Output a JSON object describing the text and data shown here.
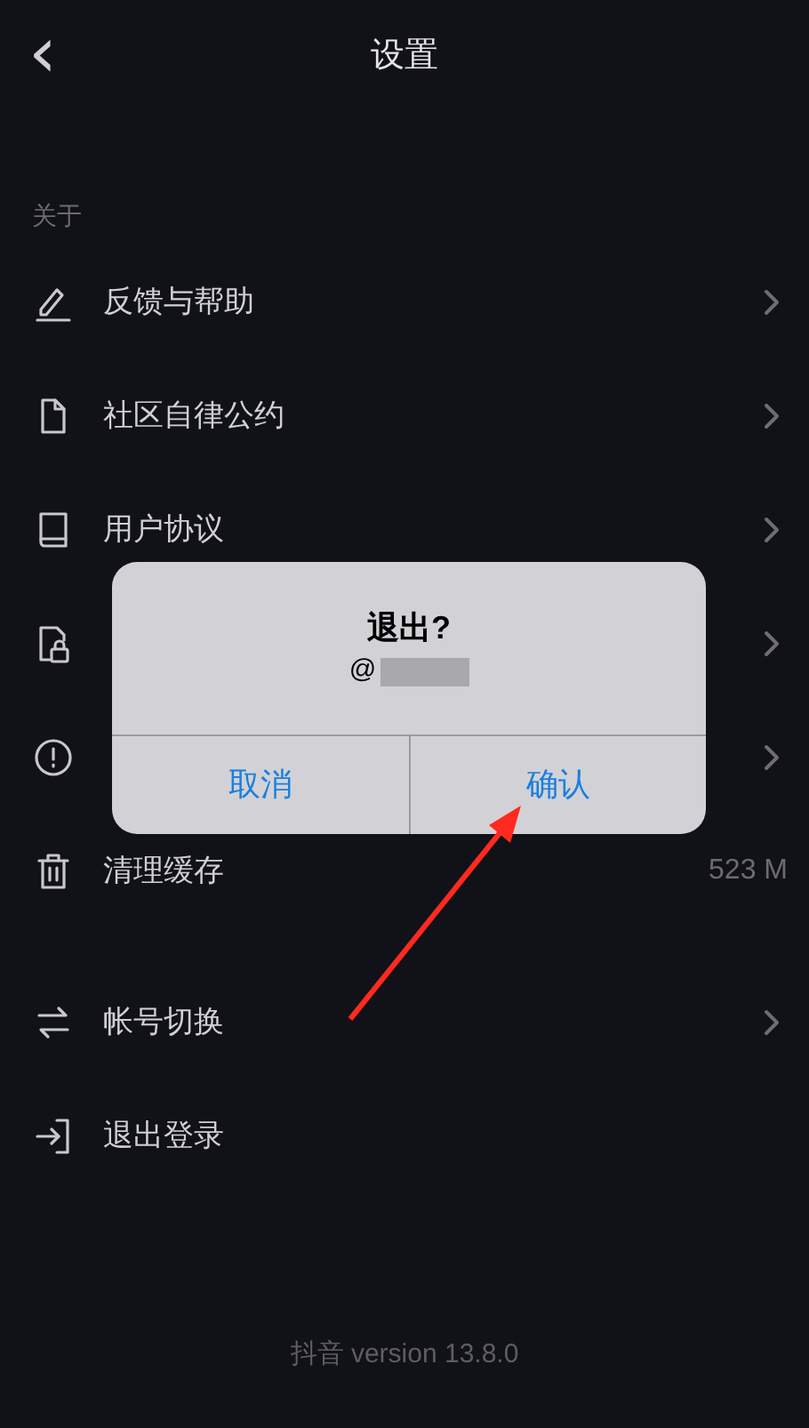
{
  "header": {
    "back_icon": "‹",
    "title": "设置"
  },
  "section": {
    "title": "关于"
  },
  "items": [
    {
      "kind": "edit",
      "label": "反馈与帮助",
      "chevron": true
    },
    {
      "kind": "document",
      "label": "社区自律公约",
      "chevron": true
    },
    {
      "kind": "book",
      "label": "用户协议",
      "chevron": true
    },
    {
      "kind": "lock",
      "chevron": true
    },
    {
      "kind": "alert",
      "chevron": true
    },
    {
      "kind": "trash",
      "label": "清理缓存",
      "value": "523 M",
      "chevron": false
    }
  ],
  "account_items": [
    {
      "kind": "switch",
      "label": "帐号切换",
      "chevron": true
    },
    {
      "kind": "logout",
      "label": "退出登录",
      "chevron": false
    }
  ],
  "footer": "抖音 version 13.8.0",
  "dialog": {
    "title": "退出?",
    "subtitle": "@",
    "buttons": [
      "取消",
      "确认"
    ]
  }
}
